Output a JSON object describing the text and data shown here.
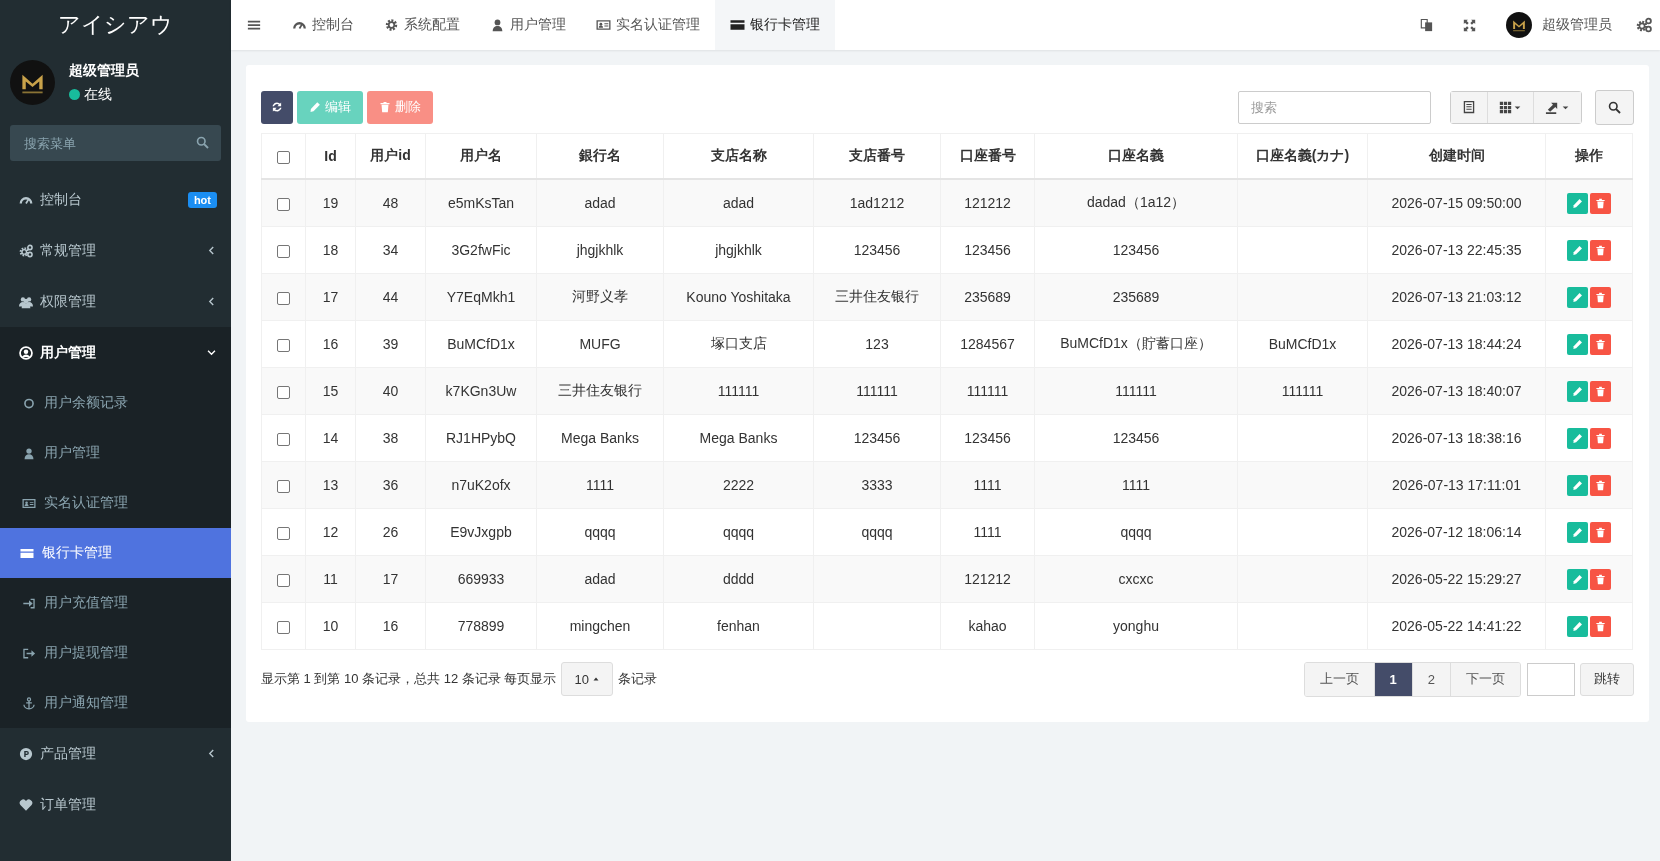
{
  "sidebar": {
    "brand": "アイシアウ",
    "user": {
      "name": "超级管理员",
      "status": "在线"
    },
    "search": {
      "placeholder": "搜索菜单"
    },
    "items": [
      {
        "kind": "link",
        "label": "控制台",
        "badge": "hot",
        "selected": false
      },
      {
        "kind": "group",
        "label": "常规管理",
        "expanded": false,
        "selected": false
      },
      {
        "kind": "group",
        "label": "权限管理",
        "expanded": false,
        "selected": false
      },
      {
        "kind": "group",
        "label": "用户管理",
        "expanded": true,
        "selected": false,
        "children": [
          {
            "label": "用户余额记录",
            "selected": false
          },
          {
            "label": "用户管理",
            "selected": false
          },
          {
            "label": "实名认证管理",
            "selected": false
          },
          {
            "label": "银行卡管理",
            "selected": true
          },
          {
            "label": "用户充值管理",
            "selected": false
          },
          {
            "label": "用户提现管理",
            "selected": false
          },
          {
            "label": "用户通知管理",
            "selected": false
          }
        ]
      },
      {
        "kind": "group",
        "label": "产品管理",
        "expanded": false,
        "selected": false
      },
      {
        "kind": "link",
        "label": "订单管理",
        "selected": false
      }
    ]
  },
  "topbar": {
    "tabs": [
      {
        "label": "控制台",
        "selected": false
      },
      {
        "label": "系统配置",
        "selected": false
      },
      {
        "label": "用户管理",
        "selected": false
      },
      {
        "label": "实名认证管理",
        "selected": false
      },
      {
        "label": "银行卡管理",
        "selected": true
      }
    ],
    "user": {
      "name": "超级管理员"
    }
  },
  "toolbar": {
    "buttons": [
      {
        "kind": "refresh",
        "disabled": false
      },
      {
        "kind": "edit",
        "label": "编辑",
        "disabled": true
      },
      {
        "kind": "delete",
        "label": "删除",
        "disabled": true
      }
    ],
    "search": {
      "placeholder": "搜索"
    }
  },
  "table": {
    "select_all": {
      "checked": false
    },
    "columns": [
      "Id",
      "用户id",
      "用户名",
      "銀行名",
      "支店名称",
      "支店番号",
      "口座番号",
      "口座名義",
      "口座名義(カナ)",
      "创建时间",
      "操作"
    ],
    "rows": [
      {
        "checked": false,
        "id": "19",
        "user_id": "48",
        "username": "e5mKsTan",
        "bank_name": "adad",
        "branch_name": "adad",
        "branch_no": "1ad1212",
        "account_no": "121212",
        "account_name": "dadad（1a12）",
        "created_at": "2026-07-15 09:50:00"
      },
      {
        "checked": false,
        "id": "18",
        "user_id": "34",
        "username": "3G2fwFic",
        "bank_name": "jhgjkhlk",
        "branch_name": "jhgjkhlk",
        "branch_no": "123456",
        "account_no": "123456",
        "account_name": "123456",
        "created_at": "2026-07-13 22:45:35"
      },
      {
        "checked": false,
        "id": "17",
        "user_id": "44",
        "username": "Y7EqMkh1",
        "bank_name": "河野义孝",
        "branch_name": "Kouno Yoshitaka",
        "branch_no": "三井住友银行",
        "account_no": "235689",
        "account_name": "235689",
        "created_at": "2026-07-13 21:03:12"
      },
      {
        "checked": false,
        "id": "16",
        "user_id": "39",
        "username": "BuMCfD1x",
        "bank_name": "MUFG",
        "branch_name": "塚口支店",
        "branch_no": "123",
        "account_no": "1284567",
        "account_name": "BuMCfD1x（貯蓄口座）",
        "account_name_kana": "BuMCfD1x",
        "created_at": "2026-07-13 18:44:24"
      },
      {
        "checked": false,
        "id": "15",
        "user_id": "40",
        "username": "k7KGn3Uw",
        "bank_name": "三井住友银行",
        "branch_name": "111111",
        "branch_no": "111111",
        "account_no": "111111",
        "account_name": "111111",
        "account_name_kana": "111111",
        "created_at": "2026-07-13 18:40:07"
      },
      {
        "checked": false,
        "id": "14",
        "user_id": "38",
        "username": "RJ1HPybQ",
        "bank_name": "Mega Banks",
        "branch_name": "Mega Banks",
        "branch_no": "123456",
        "account_no": "123456",
        "account_name": "123456",
        "created_at": "2026-07-13 18:38:16"
      },
      {
        "checked": false,
        "id": "13",
        "user_id": "36",
        "username": "n7uK2ofx",
        "bank_name": "1111",
        "branch_name": "2222",
        "branch_no": "3333",
        "account_no": "1111",
        "account_name": "1111",
        "created_at": "2026-07-13 17:11:01"
      },
      {
        "checked": false,
        "id": "12",
        "user_id": "26",
        "username": "E9vJxgpb",
        "bank_name": "qqqq",
        "branch_name": "qqqq",
        "branch_no": "qqqq",
        "account_no": "1111",
        "account_name": "qqqq",
        "created_at": "2026-07-12 18:06:14"
      },
      {
        "checked": false,
        "id": "11",
        "user_id": "17",
        "username": "669933",
        "bank_name": "adad",
        "branch_name": "dddd",
        "account_no": "121212",
        "account_name": "cxcxc",
        "created_at": "2026-05-22 15:29:27"
      },
      {
        "checked": false,
        "id": "10",
        "user_id": "16",
        "username": "778899",
        "bank_name": "mingchen",
        "branch_name": "fenhan",
        "account_no": "kahao",
        "account_name": "yonghu",
        "created_at": "2026-05-22 14:41:22"
      }
    ]
  },
  "footer": {
    "summary": "显示第 1 到第 10 条记录，总共 12 条记录 每页显示",
    "page_size": "10",
    "page_size_suffix": "条记录",
    "pagination": {
      "prev": "上一页",
      "pages": [
        {
          "label": "1",
          "selected": true
        },
        {
          "label": "2",
          "selected": false
        }
      ],
      "next": "下一页",
      "jump": "跳转"
    }
  }
}
